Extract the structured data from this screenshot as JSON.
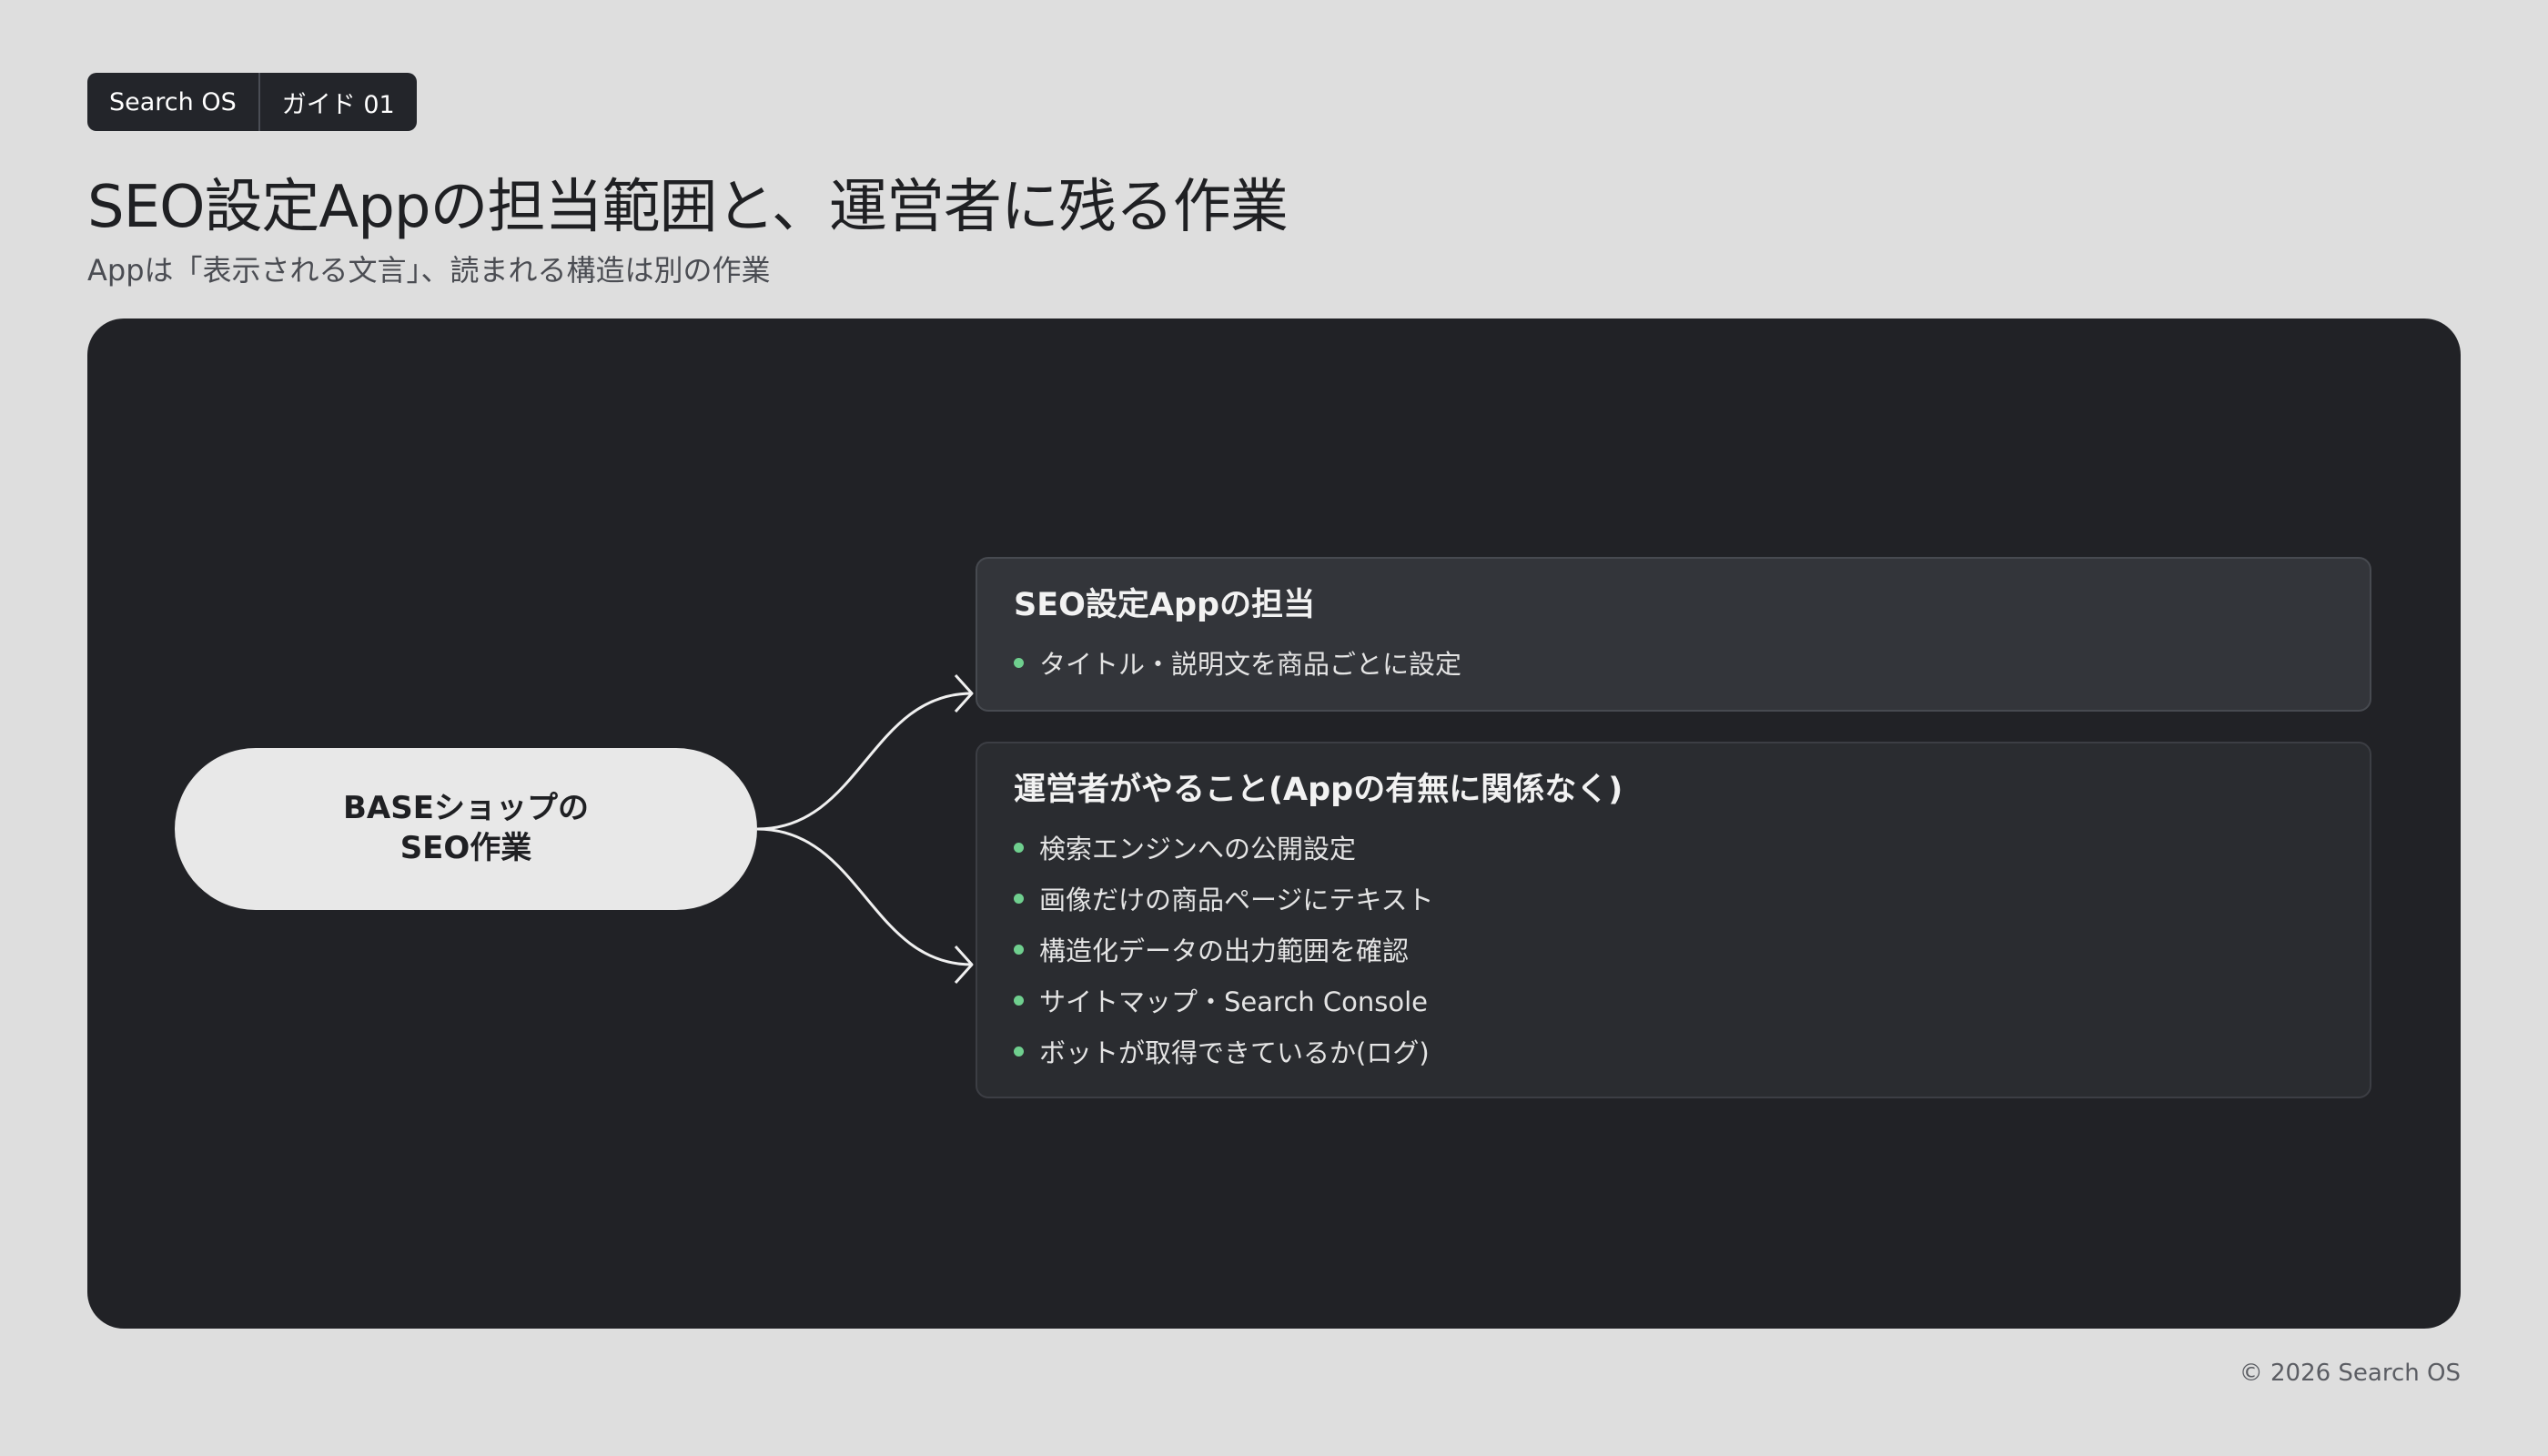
{
  "header": {
    "badge_brand": "Search OS",
    "badge_guide": "ガイド 01",
    "title": "SEO設定Appの担当範囲と、運営者に残る作業",
    "subtitle": "Appは「表示される文言」、読まれる構造は別の作業"
  },
  "diagram": {
    "root": {
      "line1": "BASEショップの",
      "line2": "SEO作業"
    },
    "branches": [
      {
        "title": "SEO設定Appの担当",
        "items": [
          "タイトル・説明文を商品ごとに設定"
        ]
      },
      {
        "title": "運営者がやること(Appの有無に関係なく)",
        "items": [
          "検索エンジンへの公開設定",
          "画像だけの商品ページにテキスト",
          "構造化データの出力範囲を確認",
          "サイトマップ・Search Console",
          "ボットが取得できているか(ログ)"
        ]
      }
    ],
    "colors": {
      "panel": "#212226",
      "root_fill": "#e8e8e8",
      "bullet": "#6fcf8e",
      "connector": "#f0f0f0"
    }
  },
  "footer": {
    "copyright": "© 2026 Search OS"
  }
}
